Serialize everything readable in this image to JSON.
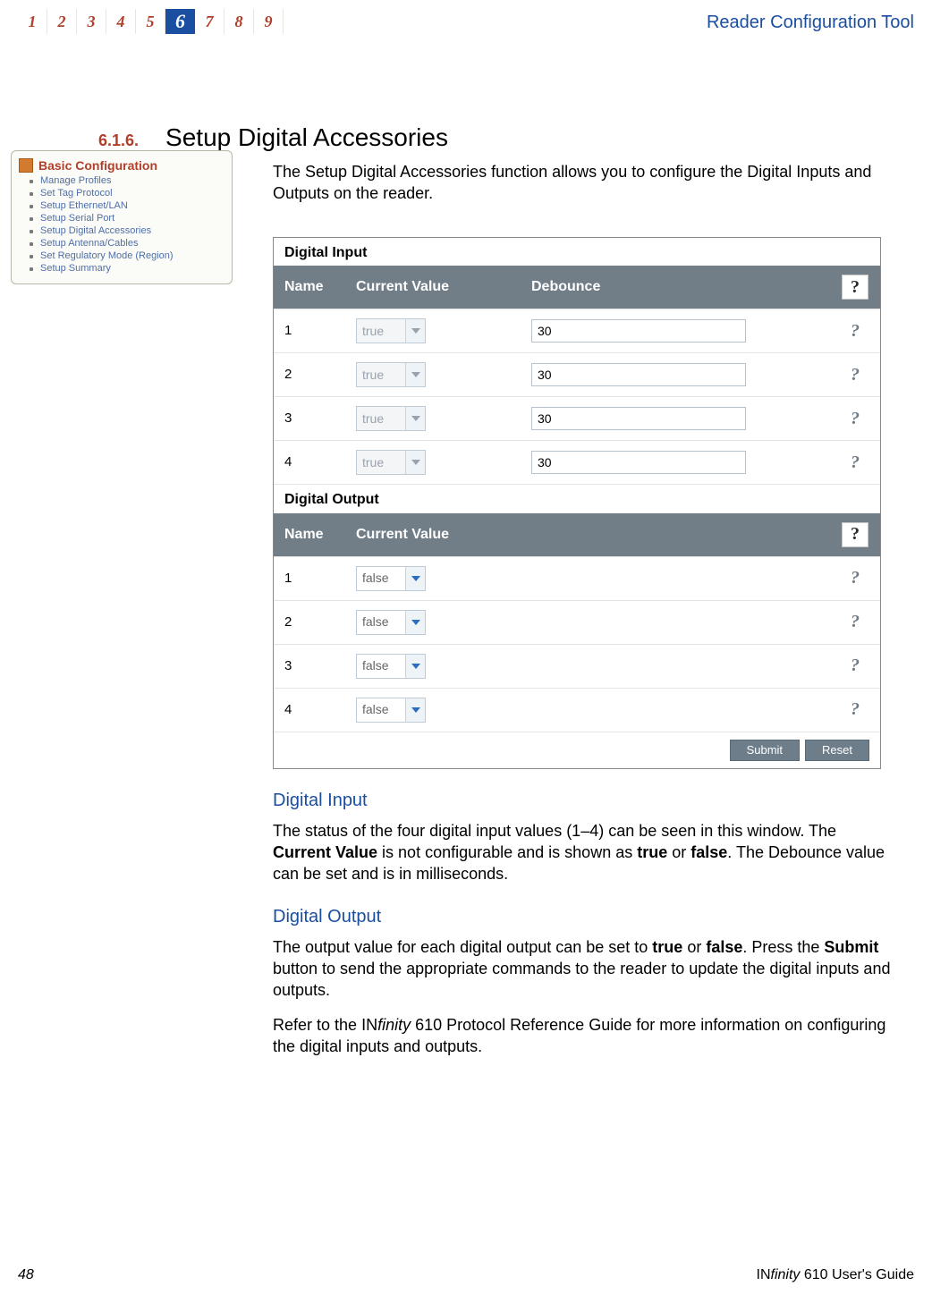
{
  "header": {
    "tabs": [
      "1",
      "2",
      "3",
      "4",
      "5",
      "6",
      "7",
      "8",
      "9"
    ],
    "active_index": 5,
    "title": "Reader Configuration Tool"
  },
  "section": {
    "number": "6.1.6.",
    "title": "Setup Digital Accessories"
  },
  "intro": "The Setup Digital Accessories function allows you to configure the Digital Inputs and Outputs on the reader.",
  "sidebar": {
    "title": "Basic Configuration",
    "items": [
      "Manage Profiles",
      "Set Tag Protocol",
      "Setup Ethernet/LAN",
      "Setup Serial Port",
      "Setup Digital Accessories",
      "Setup Antenna/Cables",
      "Set Regulatory Mode (Region)",
      "Setup Summary"
    ]
  },
  "digital_input": {
    "label": "Digital Input",
    "headers": {
      "name": "Name",
      "current": "Current Value",
      "debounce": "Debounce"
    },
    "rows": [
      {
        "name": "1",
        "current": "true",
        "debounce": "30"
      },
      {
        "name": "2",
        "current": "true",
        "debounce": "30"
      },
      {
        "name": "3",
        "current": "true",
        "debounce": "30"
      },
      {
        "name": "4",
        "current": "true",
        "debounce": "30"
      }
    ]
  },
  "digital_output": {
    "label": "Digital Output",
    "headers": {
      "name": "Name",
      "current": "Current Value"
    },
    "rows": [
      {
        "name": "1",
        "current": "false"
      },
      {
        "name": "2",
        "current": "false"
      },
      {
        "name": "3",
        "current": "false"
      },
      {
        "name": "4",
        "current": "false"
      }
    ]
  },
  "buttons": {
    "submit": "Submit",
    "reset": "Reset"
  },
  "sub1": {
    "title": "Digital Input",
    "p_a": "The status of the four digital input values (1–4) can be seen in this window. The ",
    "p_b": "Current Value",
    "p_c": " is not configurable and is shown as ",
    "p_d": "true",
    "p_e": " or ",
    "p_f": "false",
    "p_g": ". The Debounce value can be set and is in milliseconds."
  },
  "sub2": {
    "title": "Digital Output",
    "p_a": "The output value for each digital output can be set to ",
    "p_b": "true",
    "p_c": " or ",
    "p_d": "false",
    "p_e": ". Press the ",
    "p_f": "Submit",
    "p_g": " button to send the appropriate commands to the reader to update the digital inputs and outputs."
  },
  "ref": {
    "a": "Refer to the ",
    "b_prefix": "IN",
    "b_ital": "finity",
    "b_rest": " 610 Protocol Reference Guide",
    "c": " for more information on configuring the digital inputs and outputs."
  },
  "footer": {
    "page": "48",
    "a": "IN",
    "b": "finity",
    "c": " 610 User's Guide"
  },
  "glyphs": {
    "q": "?"
  }
}
